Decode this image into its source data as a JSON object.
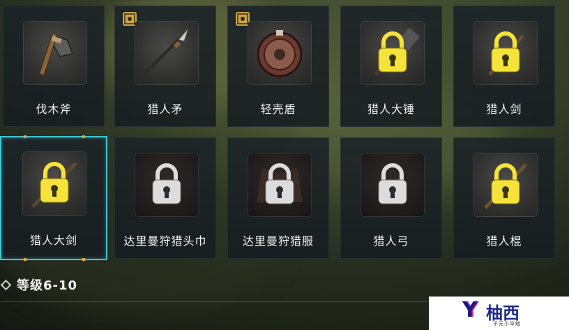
{
  "items": [
    {
      "name": "伐木斧",
      "icon": "axe-icon",
      "state": "unlocked",
      "badge": false
    },
    {
      "name": "猎人矛",
      "icon": "spear-icon",
      "state": "unlocked",
      "badge": true
    },
    {
      "name": "轻壳盾",
      "icon": "shield-icon",
      "state": "unlocked",
      "badge": true
    },
    {
      "name": "猎人大锤",
      "icon": "gold-lock-icon",
      "state": "locked-gold",
      "badge": false
    },
    {
      "name": "猎人剑",
      "icon": "gold-lock-icon",
      "state": "locked-gold",
      "badge": false
    },
    {
      "name": "猎人大剑",
      "icon": "gold-lock-icon",
      "state": "locked-gold",
      "badge": false,
      "selected": true
    },
    {
      "name": "达里曼狩猎头巾",
      "icon": "silver-lock-icon",
      "state": "locked-silver",
      "badge": false
    },
    {
      "name": "达里曼狩猎服",
      "icon": "silver-lock-icon",
      "state": "locked-silver",
      "badge": false
    },
    {
      "name": "猎人弓",
      "icon": "silver-lock-icon",
      "state": "locked-silver",
      "badge": false
    },
    {
      "name": "猎人棍",
      "icon": "gold-lock-icon",
      "state": "locked-gold",
      "badge": false
    }
  ],
  "section": {
    "level_label": "等级6-10",
    "icon": "diamond-icon"
  },
  "watermark": {
    "logo": "Y",
    "name": "柚西",
    "sub": "子元小阜魅"
  },
  "colors": {
    "accent": "#3fc6d4",
    "gold_lock": "#f5e23a",
    "silver_lock": "#dcdcdc",
    "badge": "#c9a64a"
  }
}
